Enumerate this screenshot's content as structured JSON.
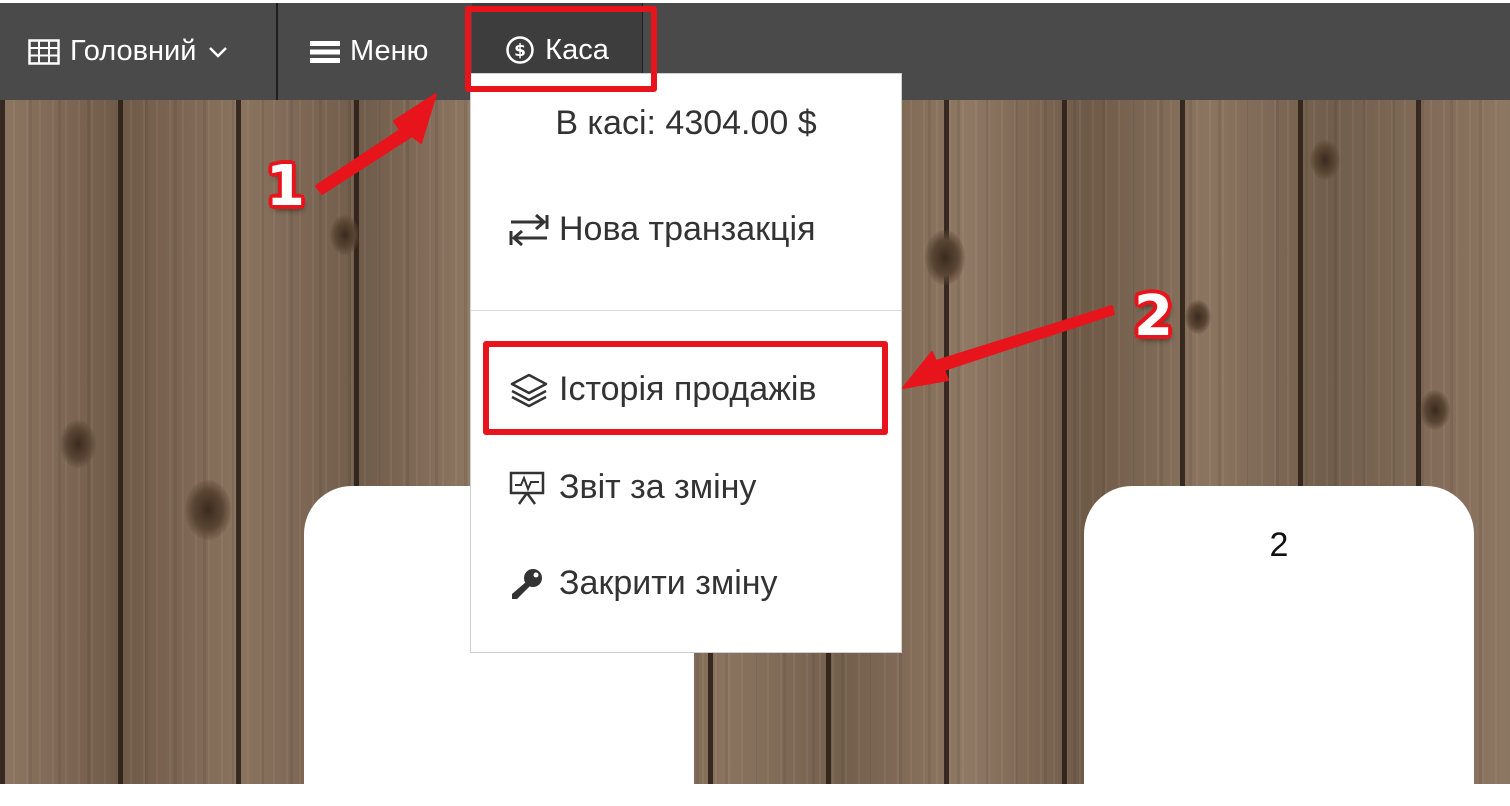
{
  "navbar": {
    "main_label": "Головний",
    "menu_label": "Меню",
    "kasa_label": "Каса",
    "icons": {
      "main": "table-grid-icon",
      "main_caret": "chevron-down-icon",
      "menu": "list-icon",
      "kasa": "dollar-circle-icon"
    }
  },
  "dropdown": {
    "balance": "В касі: 4304.00 $",
    "items": [
      {
        "label": "Нова транзакція",
        "icon": "exchange-arrows-icon"
      },
      {
        "label": "Історія продажів",
        "icon": "layers-icon"
      },
      {
        "label": "Звіт за зміну",
        "icon": "presentation-chart-icon"
      },
      {
        "label": "Закрити зміну",
        "icon": "key-icon"
      }
    ]
  },
  "cards": {
    "right_label": "2"
  },
  "annotations": {
    "step1": "1",
    "step2": "2",
    "highlight_color": "#e8141c"
  },
  "colors": {
    "navbar_bg": "#4a4a4a",
    "dropdown_text": "#333333"
  }
}
